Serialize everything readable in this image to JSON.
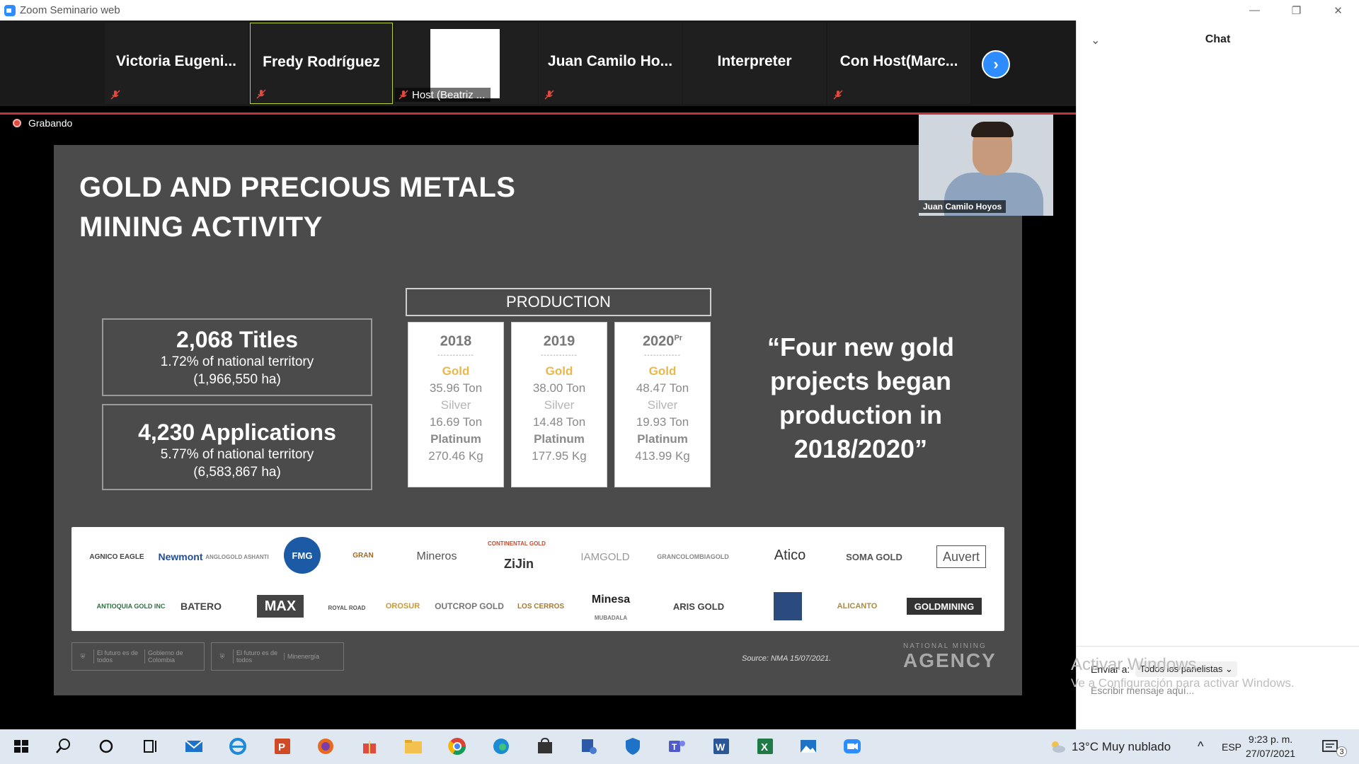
{
  "window": {
    "title": "Zoom Seminario web",
    "minimize": "—",
    "restore": "❐",
    "close": "✕"
  },
  "gallery": {
    "tiles": [
      {
        "name": "Victoria  Eugeni..."
      },
      {
        "name": "Fredy Rodríguez"
      },
      {
        "name": "Host (Beatriz ..."
      },
      {
        "name": "Juan Camilo Ho..."
      },
      {
        "name": "Interpreter"
      },
      {
        "name": "Con Host(Marc..."
      }
    ],
    "next": "›"
  },
  "recording": {
    "label": "Grabando"
  },
  "slide": {
    "title_line1": "GOLD AND PRECIOUS METALS",
    "title_line2": "MINING ACTIVITY",
    "titles": {
      "big": "2,068 Titles",
      "line1": "1.72% of national territory",
      "line2": "(1,966,550 ha)"
    },
    "applications": {
      "big": "4,230 Applications",
      "line1": "5.77% of national territory",
      "line2": "(6,583,867 ha)"
    },
    "production_label": "PRODUCTION",
    "years": [
      {
        "year": "2018",
        "sup": "",
        "gold_label": "Gold",
        "gold": "35.96 Ton",
        "silver_label": "Silver",
        "silver": "16.69 Ton",
        "platinum_label": "Platinum",
        "platinum": "270.46 Kg"
      },
      {
        "year": "2019",
        "sup": "",
        "gold_label": "Gold",
        "gold": "38.00 Ton",
        "silver_label": "Silver",
        "silver": "14.48 Ton",
        "platinum_label": "Platinum",
        "platinum": "177.95 Kg"
      },
      {
        "year": "2020",
        "sup": "Pr",
        "gold_label": "Gold",
        "gold": "48.47 Ton",
        "silver_label": "Silver",
        "silver": "19.93 Ton",
        "platinum_label": "Platinum",
        "platinum": "413.99 Kg"
      }
    ],
    "dash": "------------",
    "quote": "“Four new gold projects began production in 2018/2020”",
    "logos_row1": [
      "AGNICO EAGLE",
      "Newmont",
      "ANGLOGOLD ASHANTI",
      "FMG",
      "GRAN",
      "Mineros",
      "CONTINENTAL GOLD",
      "ZiJin",
      "IAMGOLD",
      "GRANCOLOMBIAGOLD",
      "Atico",
      "SOMA GOLD",
      "Auvert"
    ],
    "logos_row2": [
      "ANTIOQUIA GOLD INC",
      "BATERO",
      "MAX",
      "ROYAL ROAD",
      "OROSUR",
      "OUTCROP GOLD",
      "LOS CERROS",
      "Minesa",
      "MUBADALA",
      "ARIS GOLD",
      "",
      "ALICANTO",
      "GOLDMINING"
    ],
    "footer": {
      "badge1a": "El futuro es de todos",
      "badge1b": "Gobierno de Colombia",
      "badge2a": "El futuro es de todos",
      "badge2b": "Minenergía"
    },
    "source": "Source: NMA 15/07/2021.",
    "nma_line1": "NATIONAL MINING",
    "nma_line2": "AGENCY"
  },
  "camera": {
    "label": "Juan Camilo Hoyos"
  },
  "chat": {
    "title": "Chat",
    "chevron": "⌄",
    "to_label": "Enviar a:",
    "to_value": "Todos los panelistas ⌄",
    "placeholder": "Escribir mensaje aquí..."
  },
  "watermark": {
    "line1": "Activar Windows",
    "line2": "Ve a Configuración para activar Windows."
  },
  "taskbar": {
    "weather": "13°C  Muy nublado",
    "lang": "ESP",
    "time": "9:23 p. m.",
    "date": "27/07/2021",
    "notifications": "3",
    "tray_arrow": "^"
  }
}
